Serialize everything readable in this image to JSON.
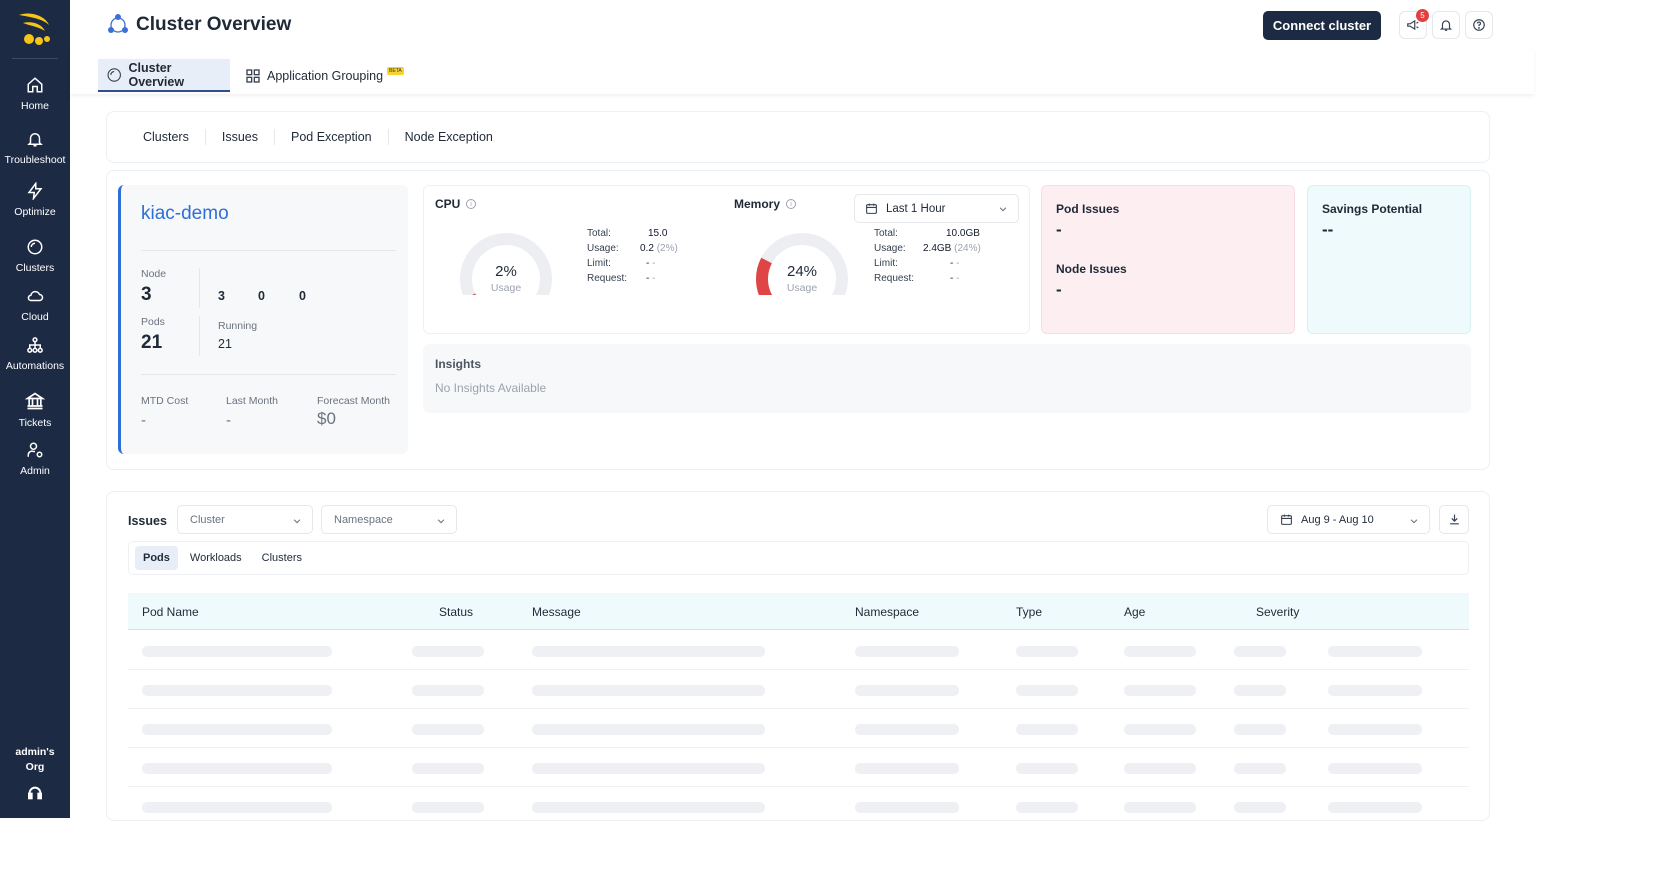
{
  "app": {
    "accent": "#1d2a44",
    "link_color": "#2d6fd6"
  },
  "sidebar": {
    "items": [
      {
        "label": "Home",
        "icon": "home-icon"
      },
      {
        "label": "Troubleshoot",
        "icon": "bell-icon"
      },
      {
        "label": "Optimize",
        "icon": "bolt-icon"
      },
      {
        "label": "Clusters",
        "icon": "clusters-icon"
      },
      {
        "label": "Cloud",
        "icon": "cloud-icon"
      },
      {
        "label": "Automations",
        "icon": "network-icon"
      },
      {
        "label": "Tickets",
        "icon": "bank-icon"
      },
      {
        "label": "Admin",
        "icon": "user-gear-icon"
      }
    ],
    "org": "admin's Org"
  },
  "header": {
    "title": "Cluster Overview",
    "connect_label": "Connect cluster",
    "notification_count": "5"
  },
  "top_tabs": [
    {
      "label": "Cluster Overview"
    },
    {
      "label": "Application Grouping",
      "badge": "BETA"
    }
  ],
  "sub_tabs": [
    "Clusters",
    "Issues",
    "Pod Exception",
    "Node Exception"
  ],
  "cluster": {
    "name": "kiac-demo",
    "node_label": "Node",
    "node_count": "3",
    "node_status": [
      "3",
      "0",
      "0"
    ],
    "pods_label": "Pods",
    "pods_count": "21",
    "running_label": "Running",
    "running_count": "21",
    "mtd_cost_label": "MTD Cost",
    "mtd_cost": "-",
    "last_month_label": "Last Month",
    "last_month": "-",
    "forecast_label": "Forecast Month",
    "forecast": "$0"
  },
  "cpu": {
    "title": "CPU",
    "pct_label": "2%",
    "pct_value": 2,
    "usage_label": "Usage",
    "rows": [
      {
        "k": "Total:",
        "v": "15.0",
        "extra": ""
      },
      {
        "k": "Usage:",
        "v": "0.2",
        "extra": "(2%)"
      },
      {
        "k": "Limit:",
        "v": "-",
        "extra": "-"
      },
      {
        "k": "Request:",
        "v": "-",
        "extra": "-"
      }
    ]
  },
  "memory": {
    "title": "Memory",
    "pct_label": "24%",
    "pct_value": 24,
    "usage_label": "Usage",
    "rows": [
      {
        "k": "Total:",
        "v": "10.0GB",
        "extra": ""
      },
      {
        "k": "Usage:",
        "v": "2.4GB",
        "extra": "(24%)"
      },
      {
        "k": "Limit:",
        "v": "-",
        "extra": "-"
      },
      {
        "k": "Request:",
        "v": "-",
        "extra": "-"
      }
    ]
  },
  "time_range": "Last 1 Hour",
  "pod_issues": {
    "label": "Pod Issues",
    "value": "-"
  },
  "node_issues": {
    "label": "Node Issues",
    "value": "-"
  },
  "savings": {
    "label": "Savings Potential",
    "value": "--"
  },
  "insights": {
    "title": "Insights",
    "empty": "No Insights Available"
  },
  "issues": {
    "title": "Issues",
    "cluster_placeholder": "Cluster",
    "namespace_placeholder": "Namespace",
    "date_range": "Aug 9 - Aug 10",
    "tabs": [
      "Pods",
      "Workloads",
      "Clusters"
    ],
    "columns": [
      "Pod Name",
      "Status",
      "Message",
      "Namespace",
      "Type",
      "Age",
      "Severity"
    ]
  }
}
